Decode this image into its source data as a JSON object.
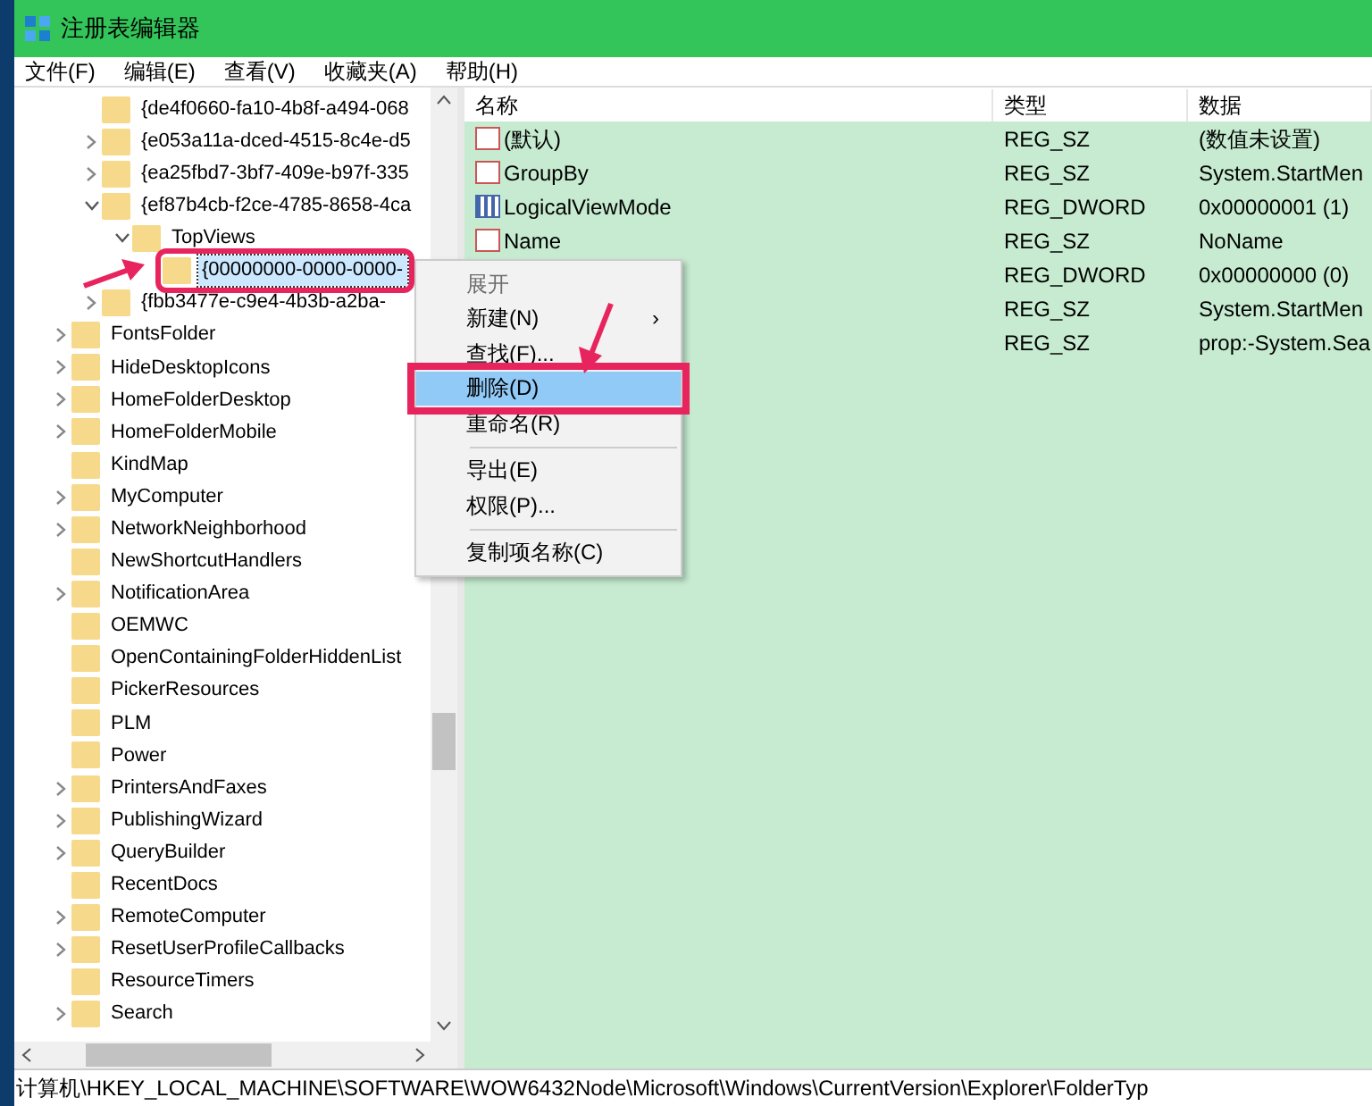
{
  "window": {
    "title": "注册表编辑器"
  },
  "menu": [
    "文件(F)",
    "编辑(E)",
    "查看(V)",
    "收藏夹(A)",
    "帮助(H)"
  ],
  "tree": {
    "continued_children": [
      {
        "label": "{de4f0660-fa10-4b8f-a494-068",
        "expandable": false,
        "selected": false
      },
      {
        "label": "{e053a11a-dced-4515-8c4e-d5",
        "expandable": true,
        "expanded": false,
        "selected": false
      },
      {
        "label": "{ea25fbd7-3bf7-409e-b97f-335",
        "expandable": true,
        "expanded": false,
        "selected": false
      },
      {
        "label": "{ef87b4cb-f2ce-4785-8658-4ca",
        "expandable": true,
        "expanded": true,
        "selected": false,
        "children": [
          {
            "label": "TopViews",
            "expandable": true,
            "expanded": true,
            "selected": false,
            "children": [
              {
                "label": "{00000000-0000-0000-",
                "expandable": false,
                "selected": true
              }
            ]
          }
        ]
      },
      {
        "label": "{fbb3477e-c9e4-4b3b-a2ba-",
        "expandable": true,
        "expanded": false,
        "selected": false
      }
    ],
    "items": [
      {
        "label": "FontsFolder",
        "expandable": true,
        "expanded": false,
        "selected": false
      },
      {
        "label": "HideDesktopIcons",
        "expandable": true,
        "expanded": false,
        "selected": false
      },
      {
        "label": "HomeFolderDesktop",
        "expandable": true,
        "expanded": false,
        "selected": false
      },
      {
        "label": "HomeFolderMobile",
        "expandable": true,
        "expanded": false,
        "selected": false
      },
      {
        "label": "KindMap",
        "expandable": false,
        "selected": false
      },
      {
        "label": "MyComputer",
        "expandable": true,
        "expanded": false,
        "selected": false
      },
      {
        "label": "NetworkNeighborhood",
        "expandable": true,
        "expanded": false,
        "selected": false
      },
      {
        "label": "NewShortcutHandlers",
        "expandable": false,
        "selected": false
      },
      {
        "label": "NotificationArea",
        "expandable": true,
        "expanded": false,
        "selected": false
      },
      {
        "label": "OEMWC",
        "expandable": false,
        "selected": false
      },
      {
        "label": "OpenContainingFolderHiddenList",
        "expandable": false,
        "selected": false
      },
      {
        "label": "PickerResources",
        "expandable": false,
        "selected": false
      },
      {
        "label": "PLM",
        "expandable": false,
        "selected": false
      },
      {
        "label": "Power",
        "expandable": false,
        "selected": false
      },
      {
        "label": "PrintersAndFaxes",
        "expandable": true,
        "expanded": false,
        "selected": false
      },
      {
        "label": "PublishingWizard",
        "expandable": true,
        "expanded": false,
        "selected": false
      },
      {
        "label": "QueryBuilder",
        "expandable": true,
        "expanded": false,
        "selected": false
      },
      {
        "label": "RecentDocs",
        "expandable": false,
        "selected": false
      },
      {
        "label": "RemoteComputer",
        "expandable": true,
        "expanded": false,
        "selected": false
      },
      {
        "label": "ResetUserProfileCallbacks",
        "expandable": true,
        "expanded": false,
        "selected": false
      },
      {
        "label": "ResourceTimers",
        "expandable": false,
        "selected": false
      },
      {
        "label": "Search",
        "expandable": true,
        "expanded": false,
        "selected": false
      }
    ]
  },
  "values": {
    "columns": [
      "名称",
      "类型",
      "数据"
    ],
    "rows": [
      {
        "name": "(默认)",
        "kind": "string",
        "type": "REG_SZ",
        "data": "(数值未设置)"
      },
      {
        "name": "GroupBy",
        "kind": "string",
        "type": "REG_SZ",
        "data": "System.StartMen"
      },
      {
        "name": "LogicalViewMode",
        "kind": "binary",
        "type": "REG_DWORD",
        "data": "0x00000001 (1)"
      },
      {
        "name": "Name",
        "kind": "string",
        "type": "REG_SZ",
        "data": "NoName"
      },
      {
        "type": "REG_DWORD",
        "data": "0x00000000 (0)"
      },
      {
        "type": "REG_SZ",
        "data": "System.StartMen"
      },
      {
        "type": "REG_SZ",
        "data": "prop:-System.Sea"
      }
    ]
  },
  "context_menu": [
    {
      "kind": "item",
      "label": "展开",
      "disabled": true,
      "selected": false
    },
    {
      "kind": "submenu",
      "label": "新建(N)",
      "arrow": "›",
      "disabled": false,
      "selected": false
    },
    {
      "kind": "item",
      "label": "查找(F)...",
      "disabled": false,
      "selected": false
    },
    {
      "kind": "item",
      "label": "删除(D)",
      "disabled": false,
      "selected": true
    },
    {
      "kind": "item",
      "label": "重命名(R)",
      "disabled": false,
      "selected": false
    },
    {
      "kind": "separator"
    },
    {
      "kind": "item",
      "label": "导出(E)",
      "disabled": false,
      "selected": false
    },
    {
      "kind": "item",
      "label": "权限(P)...",
      "disabled": false,
      "selected": false
    },
    {
      "kind": "separator"
    },
    {
      "kind": "item",
      "label": "复制项名称(C)",
      "disabled": false,
      "selected": false
    }
  ],
  "status_bar": "计算机\\HKEY_LOCAL_MACHINE\\SOFTWARE\\WOW6432Node\\Microsoft\\Windows\\CurrentVersion\\Explorer\\FolderTyp"
}
